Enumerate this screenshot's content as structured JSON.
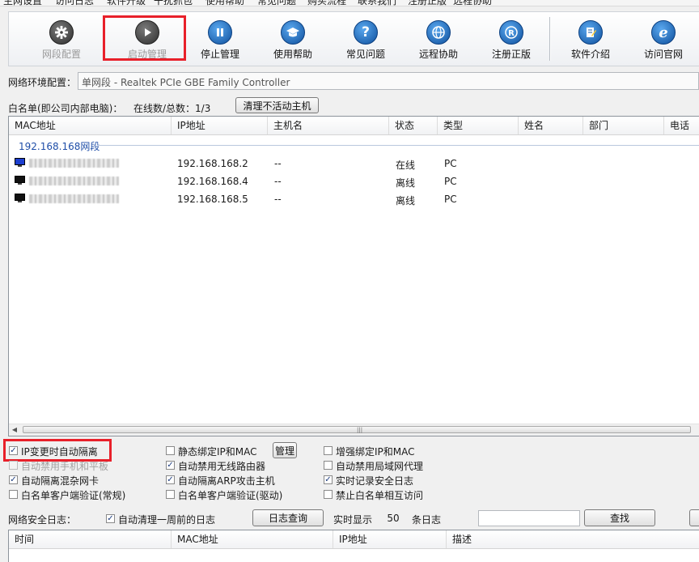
{
  "menubar": [
    "主网设置",
    "访问日志",
    "软件升级",
    "干扰抓包",
    "使用帮助",
    "常见问题",
    "购买流程",
    "联系我们",
    "注册正版",
    "远程协助"
  ],
  "toolbar": {
    "items": [
      {
        "label": "网段配置",
        "icon": "gear-icon",
        "disabled": true
      },
      {
        "label": "启动管理",
        "icon": "play-icon",
        "disabled": true
      },
      {
        "label": "停止管理",
        "icon": "pause-icon",
        "disabled": false
      },
      {
        "label": "使用帮助",
        "icon": "graduation-cap-icon",
        "disabled": false
      },
      {
        "label": "常见问题",
        "icon": "question-icon",
        "disabled": false
      },
      {
        "label": "远程协助",
        "icon": "globe-icon",
        "disabled": false
      },
      {
        "label": "注册正版",
        "icon": "registered-icon",
        "disabled": false
      },
      {
        "label": "软件介绍",
        "icon": "document-edit-icon",
        "disabled": false
      },
      {
        "label": "访问官网",
        "icon": "ie-browser-icon",
        "disabled": false
      }
    ]
  },
  "network": {
    "label": "网络环境配置：",
    "value": "单网段 - Realtek PCIe GBE Family Controller"
  },
  "whitelist": {
    "label": "白名单(即公司内部电脑)：",
    "count": "在线数/总数：1/3",
    "clear_button": "清理不活动主机"
  },
  "hosts": {
    "columns": [
      "MAC地址",
      "IP地址",
      "主机名",
      "状态",
      "类型",
      "姓名",
      "部门",
      "电话"
    ],
    "group": "192.168.168网段",
    "rows": [
      {
        "ip": "192.168.168.2",
        "hostname": "--",
        "status": "在线",
        "type": "PC",
        "online": true
      },
      {
        "ip": "192.168.168.4",
        "hostname": "--",
        "status": "离线",
        "type": "PC",
        "online": false
      },
      {
        "ip": "192.168.168.5",
        "hostname": "--",
        "status": "离线",
        "type": "PC",
        "online": false
      }
    ]
  },
  "options": {
    "ip_isolate": "IP变更时自动隔离",
    "static_bind": "静态绑定IP和MAC",
    "manage_button": "管理",
    "enhanced_bind": "增强绑定IP和MAC",
    "auto_disable_mobile": "自动禁用手机和平板",
    "auto_disable_wifi_router": "自动禁用无线路由器",
    "auto_disable_lan_proxy": "自动禁用局域网代理",
    "auto_isolate_promisc": "自动隔离混杂网卡",
    "auto_isolate_arp": "自动隔离ARP攻击主机",
    "realtime_log": "实时记录安全日志",
    "whitelist_verify_normal": "白名单客户端验证(常规)",
    "whitelist_verify_driver": "白名单客户端验证(驱动)",
    "forbid_whitelist_mutual": "禁止白名单相互访问"
  },
  "log": {
    "label": "网络安全日志：",
    "auto_clean": "自动清理一周前的日志",
    "query_button": "日志查询",
    "realtime_label": "实时显示",
    "count": "50",
    "unit": "条日志",
    "search_button": "查找",
    "columns": [
      "时间",
      "MAC地址",
      "IP地址",
      "描述"
    ]
  },
  "colors": {
    "highlight": "#e8202a",
    "group": "#1f4ea8"
  }
}
